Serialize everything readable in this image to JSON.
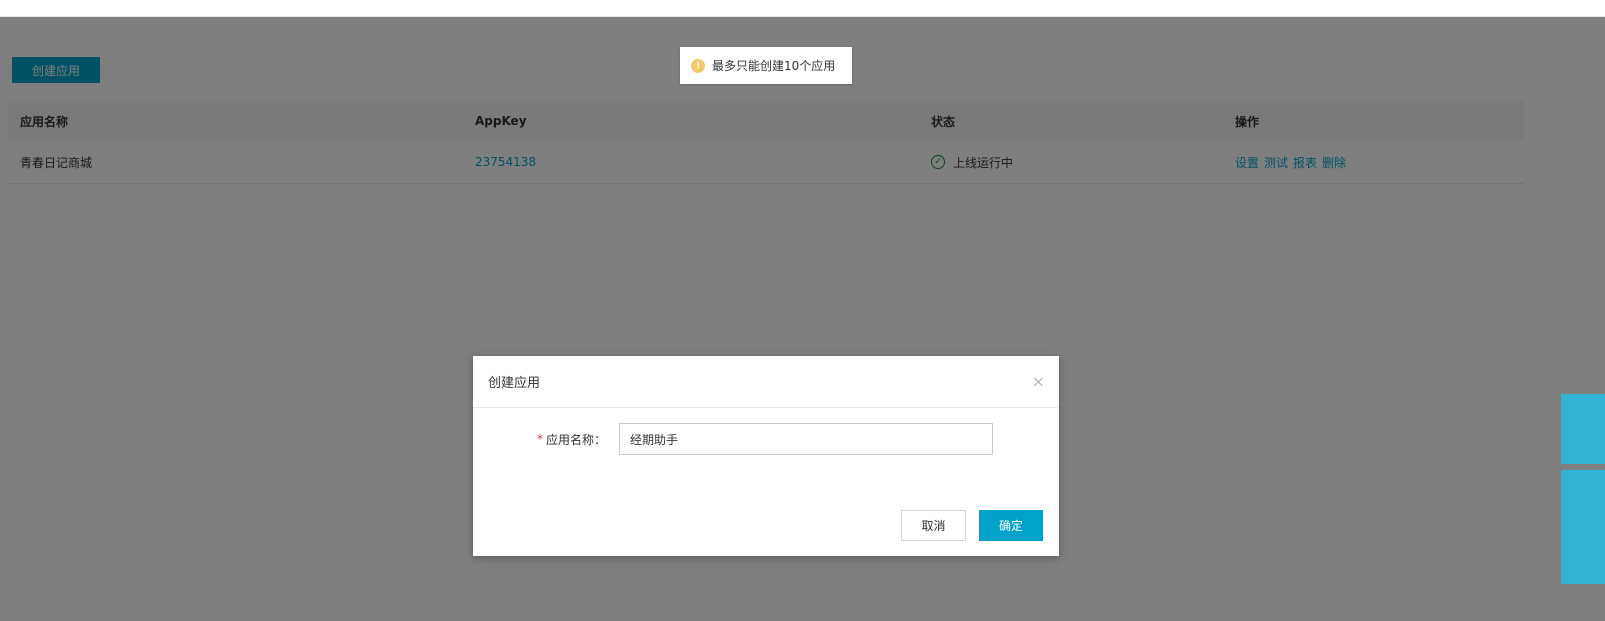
{
  "toolbar": {
    "create_label": "创建应用"
  },
  "toast": {
    "message": "最多只能创建10个应用",
    "icon": "warning-icon"
  },
  "table": {
    "headers": [
      "应用名称",
      "AppKey",
      "状态",
      "操作"
    ],
    "rows": [
      {
        "name": "青春日记商城",
        "appkey": "23754138",
        "status": "上线运行中",
        "actions": [
          "设置",
          "测试",
          "报表",
          "删除"
        ]
      }
    ]
  },
  "dialog": {
    "title": "创建应用",
    "field_label": "应用名称：",
    "field_required": "*",
    "field_value": "经期助手",
    "cancel_label": "取消",
    "ok_label": "确定",
    "close_glyph": "×"
  },
  "colors": {
    "accent": "#00a2ca",
    "overlay": "#808080",
    "warning": "#f7c86a",
    "success": "#1a8a3a"
  }
}
